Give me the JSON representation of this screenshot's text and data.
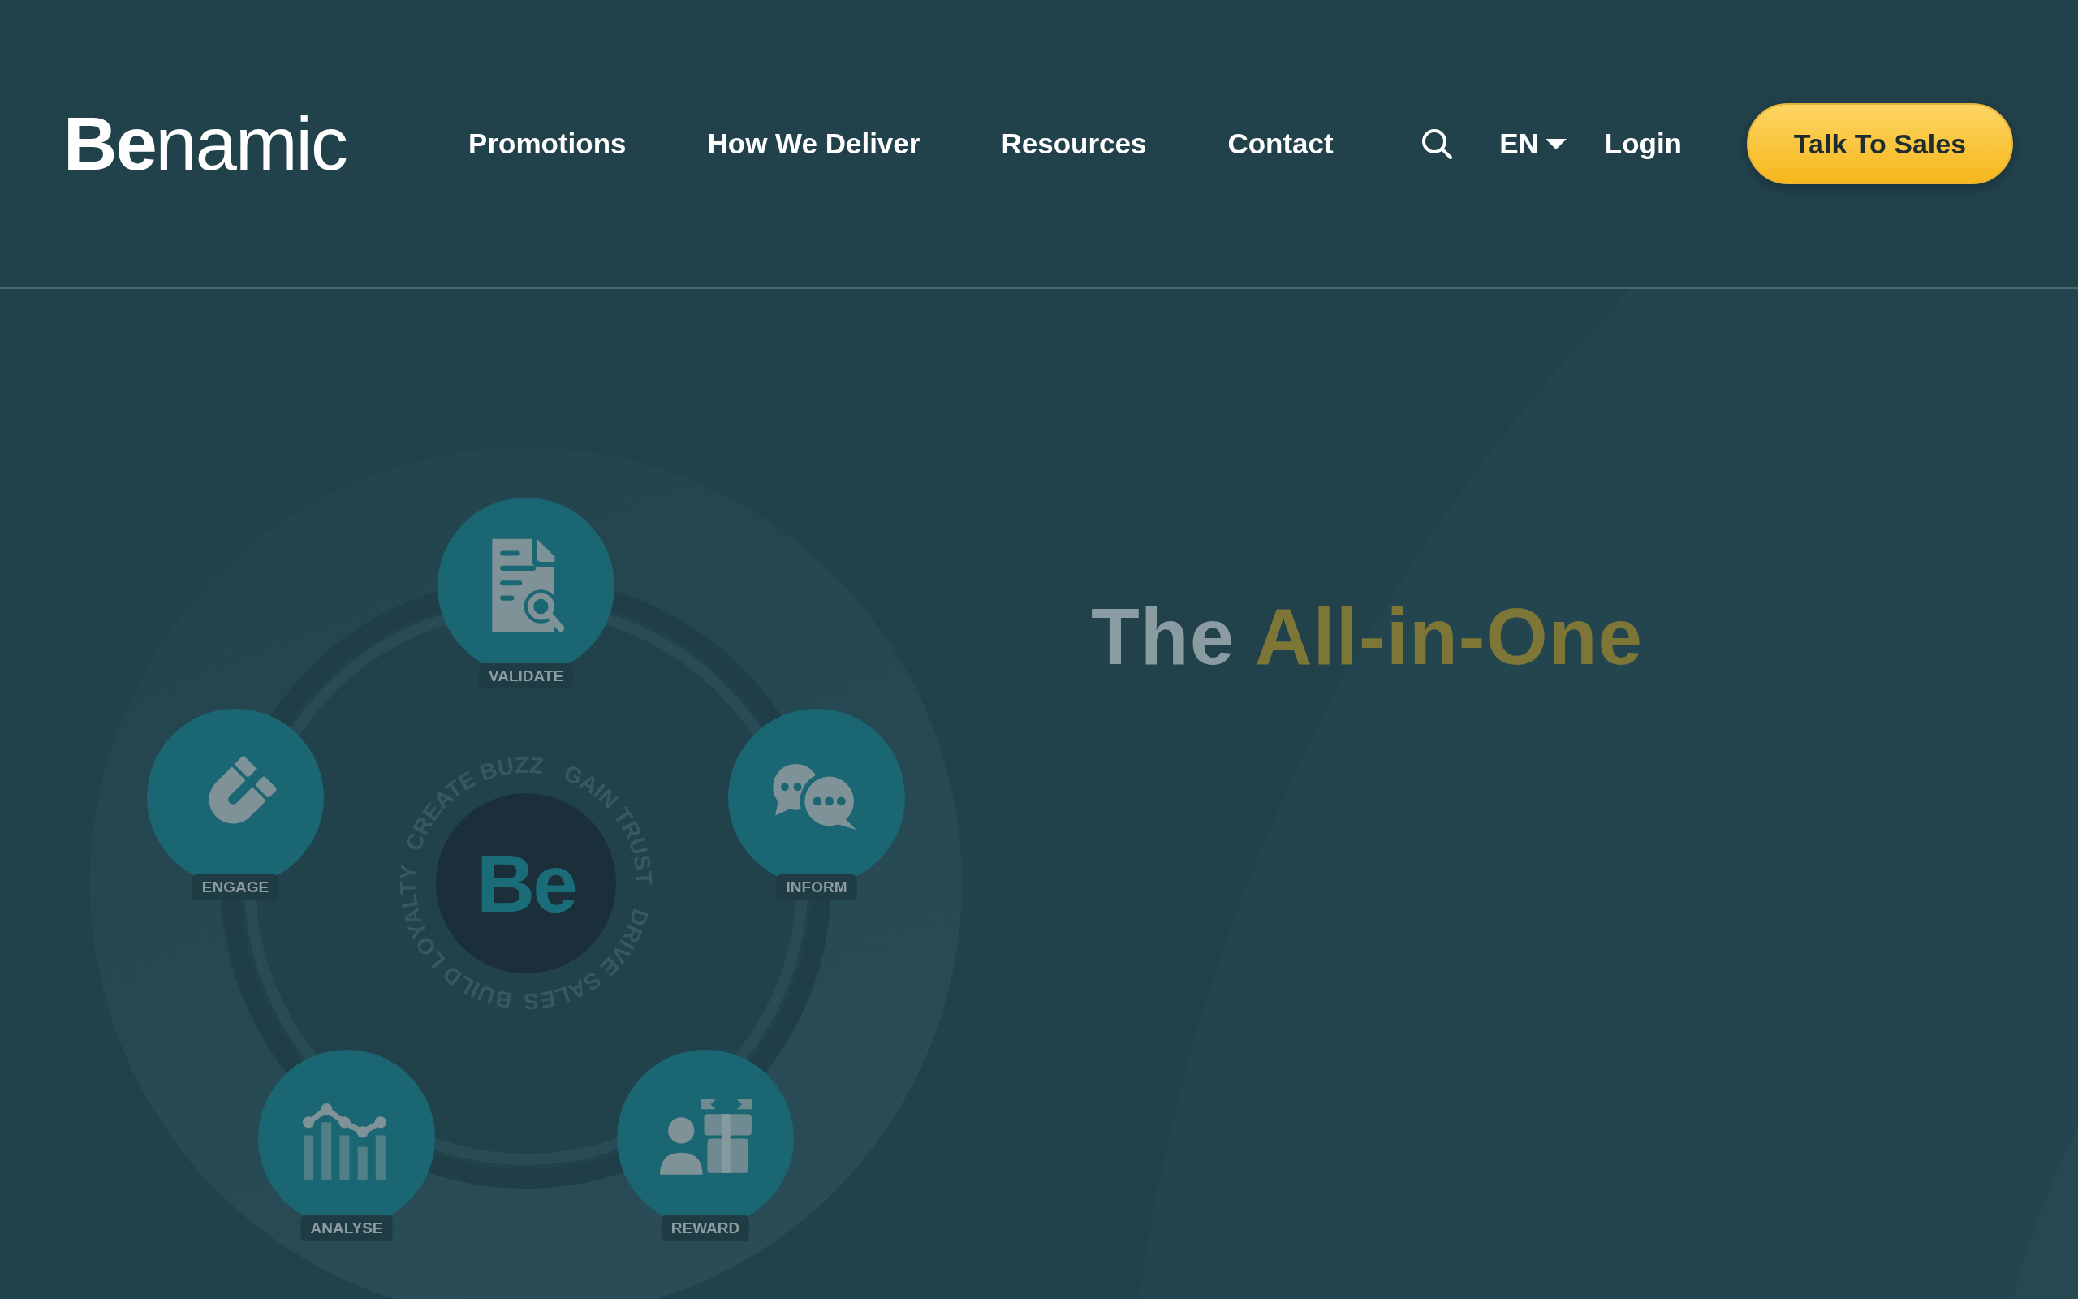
{
  "header": {
    "logo": "**Be**namic",
    "nav": [
      "Promotions",
      "How We Deliver",
      "Resources",
      "Contact"
    ],
    "language": "EN",
    "login": "Login",
    "cta": "Talk To Sales"
  },
  "diagram": {
    "center": "Be",
    "ring_texts": [
      "CREATE BUZZ",
      "GAIN TRUST",
      "BUILD LOYALTY",
      "DRIVE SALES"
    ],
    "nodes": [
      {
        "label": "VALIDATE",
        "kind": "document-search"
      },
      {
        "label": "INFORM",
        "kind": "chat"
      },
      {
        "label": "REWARD",
        "kind": "gift"
      },
      {
        "label": "ANALYSE",
        "kind": "chart"
      },
      {
        "label": "ENGAGE",
        "kind": "magnet"
      }
    ]
  },
  "hero": {
    "heading_lead": "The",
    "heading_highlight": "All-in-One"
  }
}
